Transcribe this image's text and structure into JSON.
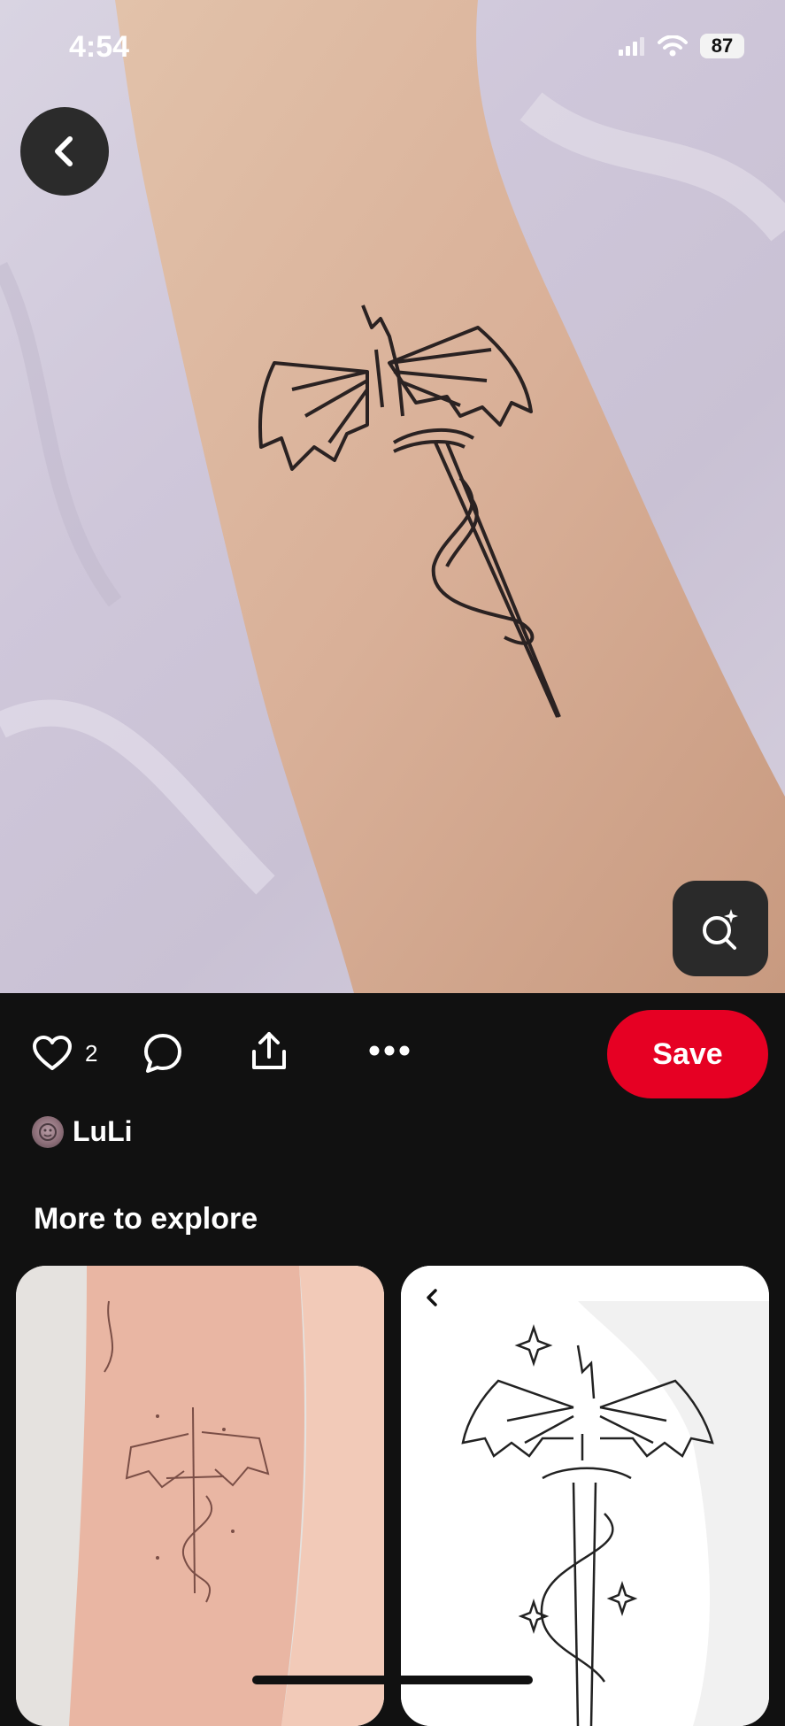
{
  "status_bar": {
    "time": "4:54",
    "battery": "87"
  },
  "pin": {
    "like_count": "2",
    "save_label": "Save",
    "author": "LuLi"
  },
  "explore": {
    "title": "More to explore"
  },
  "icons": {
    "back": "chevron-left-icon",
    "lens": "visual-search-icon",
    "like": "heart-icon",
    "comment": "comment-icon",
    "share": "share-icon",
    "more": "more-icon"
  },
  "colors": {
    "save": "#e60023",
    "background": "#111111"
  }
}
